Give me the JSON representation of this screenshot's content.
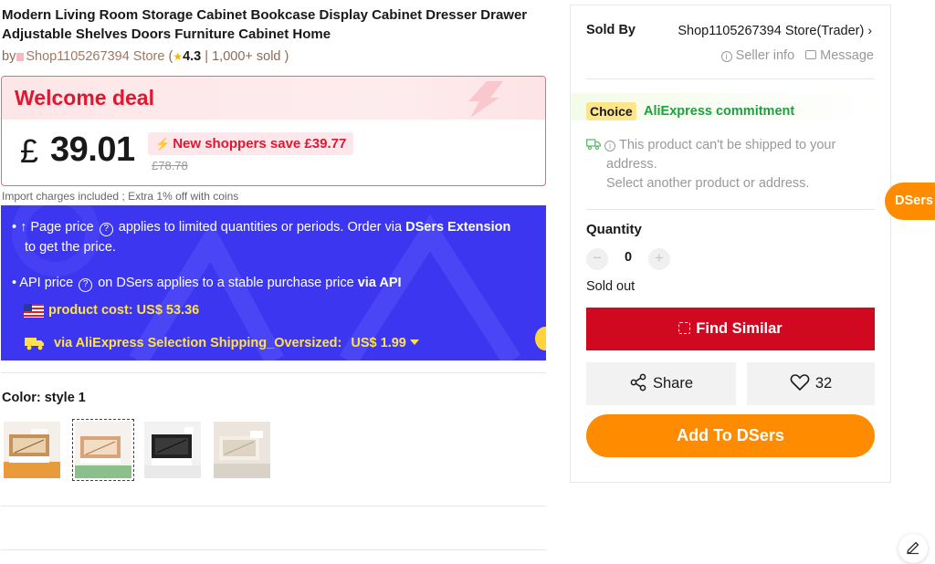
{
  "product": {
    "title": "Modern Living Room Storage Cabinet Bookcase Display Cabinet Dresser Drawer Adjustable Shelves Doors Furniture Cabinet Home",
    "by_prefix": "by",
    "store_name": "Shop1105267394 Store",
    "open_paren": "(",
    "rating": "4.3",
    "sold_sep": "|",
    "sold_text": "1,000+ sold )"
  },
  "deal": {
    "label": "Welcome deal",
    "currency": "£",
    "price": "39.01",
    "save_text": "New shoppers save £39.77",
    "original_price": "£78.78"
  },
  "import_note": "Import charges included ; Extra 1% off with coins",
  "dsers": {
    "line1_a": "• ↑ Page price",
    "line1_b": "applies to limited quantities or periods. Order via",
    "line1_bold": "DSers Extension",
    "line1_c": "to get the price.",
    "line2_a": "• API price",
    "line2_b": "on DSers applies to a stable purchase price",
    "line2_bold": "via API",
    "cost_label": "product cost:",
    "cost_value": "US$ 53.36",
    "ship_label": "via AliExpress Selection Shipping_Oversized:",
    "ship_value": "US$ 1.99"
  },
  "variants": {
    "label": "Color: style 1",
    "items": [
      "style-1",
      "style-2",
      "style-3",
      "style-4"
    ],
    "selected_index": 1
  },
  "seller": {
    "sold_by_label": "Sold By",
    "store_name": "Shop1105267394 Store(Trader)",
    "seller_info": "Seller info",
    "message": "Message"
  },
  "choice": {
    "tag": "Choice",
    "text": "AliExpress commitment"
  },
  "shipping_warning": {
    "line1": "This product can't be shipped to your",
    "line2": "address.",
    "line3": "Select another product or address."
  },
  "quantity": {
    "label": "Quantity",
    "minus": "−",
    "value": "0",
    "plus": "+",
    "status": "Sold out"
  },
  "actions": {
    "find_similar": "Find Similar",
    "share": "Share",
    "wishlist_count": "32",
    "add_to_dsers": "Add To DSers"
  },
  "floating": {
    "dsers_tab": "DSers"
  },
  "colors": {
    "accent_red": "#d10920",
    "deal_red": "#e2162e",
    "dsers_blue": "#3c36f0",
    "dsers_orange": "#ff8b00",
    "choice_green": "#1aa33b",
    "highlight_yellow": "#ffe14d"
  },
  "icons": {
    "rating": "star-icon",
    "store": "store-icon",
    "help": "question-icon",
    "flag": "us-flag-icon",
    "truck": "truck-icon",
    "info": "info-icon",
    "message": "message-icon",
    "scan": "scan-icon",
    "share": "share-icon",
    "heart": "heart-icon",
    "edit": "pencil-icon"
  }
}
